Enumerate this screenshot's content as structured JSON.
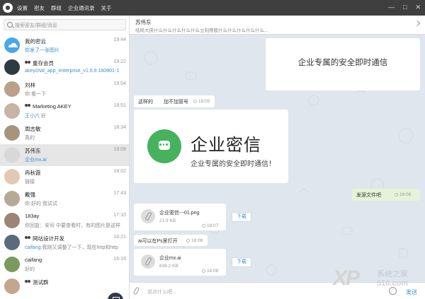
{
  "menu": [
    "设置",
    "密友",
    "群组",
    "企业通讯录",
    "关于"
  ],
  "window_buttons": [
    "—",
    "□",
    "✕"
  ],
  "search": {
    "placeholder": "搜索密友/群组/消息"
  },
  "conversations": [
    {
      "name": "我的密云",
      "time": "19:44",
      "msg": "你发了一张图片",
      "msg_style": "blue",
      "avatar": "cloud"
    },
    {
      "name": "重存会员",
      "group": true,
      "time": "19:22",
      "msg": "akeychat_app_enterprise_v1.6.9.160801-1",
      "msg_style": "blue",
      "avatar": "dark"
    },
    {
      "name": "刘林",
      "time": "19:04",
      "msg": "你:看一下",
      "msg_style": "gray",
      "avatar": "photo1"
    },
    {
      "name": "Marketing  AKEY",
      "group": true,
      "time": "18:51",
      "msg_name": "王小六",
      "msg": " 好",
      "msg_style": "gray",
      "avatar": "photo2"
    },
    {
      "name": "周志敏",
      "time": "18:34",
      "msg": "真的",
      "msg_style": "gray",
      "avatar": "photo3"
    },
    {
      "name": "苏伟东",
      "time": "18:08",
      "msg": "企业mx.ai",
      "msg_style": "blue",
      "avatar": "photo4",
      "active": true
    },
    {
      "name": "冉秋霞",
      "time": "18:02",
      "msg": "链接",
      "msg_style": "gray",
      "avatar": "photo5"
    },
    {
      "name": "戴强",
      "time": "17:43",
      "msg": "你:好的 我试试",
      "msg_style": "gray",
      "avatar": "photo6"
    },
    {
      "name": "183ay",
      "time": "17:10",
      "msg": "你回复：安司 中要查看时，有的图片是这样",
      "msg_style": "gray",
      "avatar": "photo7"
    },
    {
      "name": "网站设计开发",
      "group": true,
      "time": "16:21",
      "msg_from": "caifang:",
      "msg": "我刚又调整了一下，现在http和http",
      "msg_style": "gray",
      "avatar": "photo8"
    },
    {
      "name": "caifang",
      "time": "16:16",
      "msg": "好的",
      "msg_style": "gray",
      "avatar": "photo9"
    },
    {
      "name": "测试群",
      "group": true,
      "time": "",
      "msg": "",
      "msg_style": "gray",
      "avatar": "photo10"
    }
  ],
  "chat": {
    "title": "苏伟东",
    "subtitle": "结局大侠什么什么什么什么什么立刻用我什么什么什么什么什么...",
    "banner_top_text": "企业专属的安全即时通信",
    "msg1_text": "这样的",
    "msg1_sub": "加不加冒号",
    "msg1_time": "18:05",
    "logo_word": "企业密信",
    "logo_slogan": "企业专属的安全即时通信！",
    "out_msg": "发源文件吧",
    "out_time": "18:06",
    "file1_name": "企业密信---01.png",
    "file1_size": "21.9 KB",
    "file1_time": "18:07",
    "msg2_text": "ai可以在Ps里打开",
    "msg2_time": "18:08",
    "file2_name": "企业mx.ai",
    "file2_size": "638.2 KB",
    "file2_time": "18:08",
    "download_label": "下载",
    "input_placeholder": "说点什么吧...",
    "send_label": "发送"
  },
  "watermark": {
    "brand": "XP",
    "text": "系统之家",
    "num": "510.com"
  },
  "colors": {
    "titlebar": "#3f3f3f",
    "accent": "#3a8fd6",
    "brand_green": "#46b25e",
    "chat_bg": "#dfe6ee",
    "out_bubble": "#e6f3d8"
  }
}
